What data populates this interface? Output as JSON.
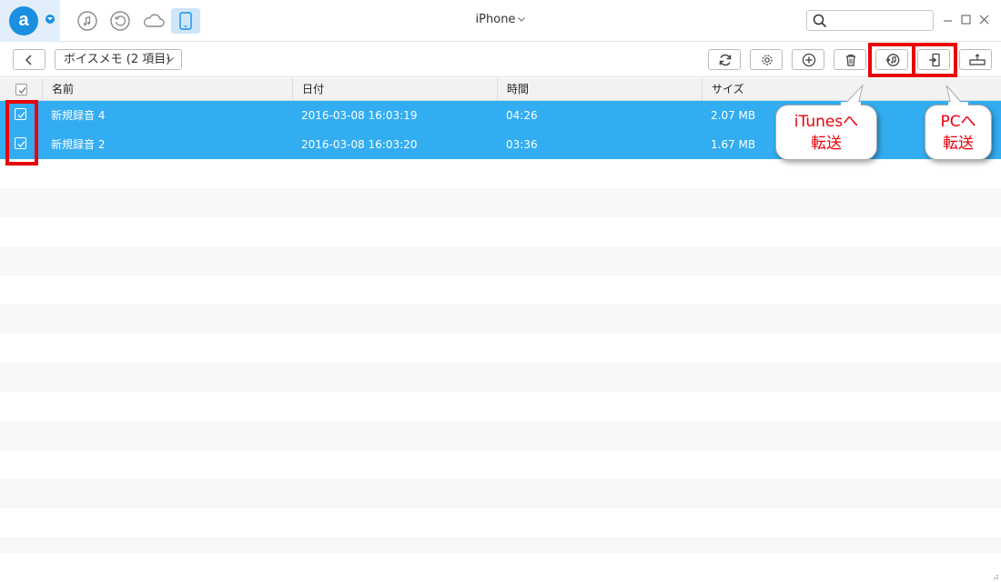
{
  "app": {
    "logo_letter": "a",
    "device_name": "iPhone",
    "search_placeholder": ""
  },
  "nav_icons": [
    "music-icon",
    "history-icon",
    "cloud-icon",
    "phone-icon"
  ],
  "toolbar": {
    "category_label": "ボイスメモ (2 項目)",
    "buttons": [
      "refresh-icon",
      "settings-icon",
      "add-icon",
      "delete-icon",
      "to-itunes-icon",
      "to-pc-icon",
      "to-device-icon"
    ]
  },
  "table": {
    "columns": [
      "名前",
      "日付",
      "時間",
      "サイズ"
    ],
    "rows": [
      {
        "name": "新規録音 4",
        "date": "2016-03-08 16:03:19",
        "duration": "04:26",
        "size": "2.07 MB",
        "selected": true
      },
      {
        "name": "新規録音 2",
        "date": "2016-03-08 16:03:20",
        "duration": "03:36",
        "size": "1.67 MB",
        "selected": true
      }
    ]
  },
  "callouts": {
    "itunes_line1": "iTunesへ",
    "itunes_line2": "転送",
    "pc_line1": "PCへ",
    "pc_line2": "転送"
  },
  "colors": {
    "selection": "#33adf2",
    "highlight": "#e8000b",
    "brand": "#1a8fe0"
  }
}
